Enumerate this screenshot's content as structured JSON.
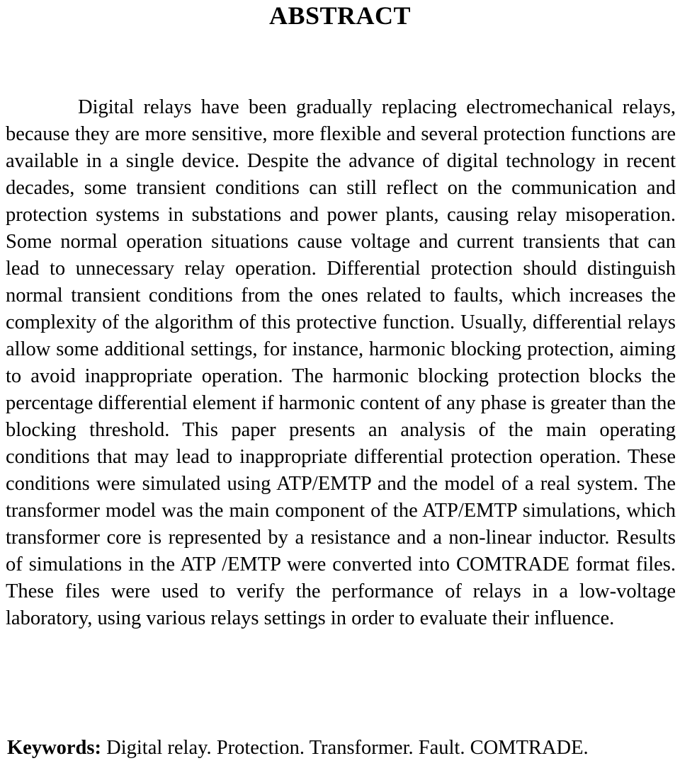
{
  "document": {
    "title": "ABSTRACT",
    "abstract_text": "Digital relays have been gradually replacing electromechanical relays, because they are more sensitive, more flexible and several protection functions are available in a single device. Despite the advance of digital technology in recent decades, some transient conditions can still reflect on the communication and protection systems in substations and power plants, causing relay misoperation. Some normal operation situations cause voltage and current transients that can lead to unnecessary relay operation. Differential protection should distinguish normal transient conditions from the ones related to faults, which increases the complexity of the algorithm of this protective function. Usually, differential relays allow some additional settings, for instance, harmonic blocking protection, aiming to avoid inappropriate operation. The harmonic blocking protection blocks the percentage differential element if harmonic content of any phase is greater than the blocking threshold. This paper presents an analysis of the main operating conditions that may lead to inappropriate differential protection operation. These conditions were simulated using ATP/EMTP and the model of a real system. The transformer model was the main component of the ATP/EMTP simulations, which transformer core is represented by a resistance and a non-linear inductor. Results of simulations in the ATP /EMTP were converted into COMTRADE format files. These files were used to verify the performance of relays in a low-voltage laboratory, using various relays settings in order to evaluate their influence.",
    "keywords": {
      "label": "Keywords",
      "separator": ":",
      "terms": "Digital relay. Protection. Transformer. Fault. COMTRADE.",
      "full_line": "Keywords: Digital relay. Protection. Transformer. Fault. COMTRADE."
    }
  }
}
